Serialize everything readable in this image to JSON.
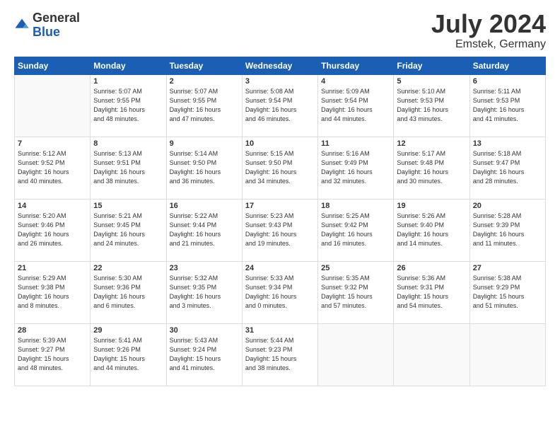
{
  "logo": {
    "general": "General",
    "blue": "Blue"
  },
  "title": {
    "month": "July 2024",
    "location": "Emstek, Germany"
  },
  "days_of_week": [
    "Sunday",
    "Monday",
    "Tuesday",
    "Wednesday",
    "Thursday",
    "Friday",
    "Saturday"
  ],
  "weeks": [
    [
      {
        "day": "",
        "info": ""
      },
      {
        "day": "1",
        "info": "Sunrise: 5:07 AM\nSunset: 9:55 PM\nDaylight: 16 hours\nand 48 minutes."
      },
      {
        "day": "2",
        "info": "Sunrise: 5:07 AM\nSunset: 9:55 PM\nDaylight: 16 hours\nand 47 minutes."
      },
      {
        "day": "3",
        "info": "Sunrise: 5:08 AM\nSunset: 9:54 PM\nDaylight: 16 hours\nand 46 minutes."
      },
      {
        "day": "4",
        "info": "Sunrise: 5:09 AM\nSunset: 9:54 PM\nDaylight: 16 hours\nand 44 minutes."
      },
      {
        "day": "5",
        "info": "Sunrise: 5:10 AM\nSunset: 9:53 PM\nDaylight: 16 hours\nand 43 minutes."
      },
      {
        "day": "6",
        "info": "Sunrise: 5:11 AM\nSunset: 9:53 PM\nDaylight: 16 hours\nand 41 minutes."
      }
    ],
    [
      {
        "day": "7",
        "info": "Sunrise: 5:12 AM\nSunset: 9:52 PM\nDaylight: 16 hours\nand 40 minutes."
      },
      {
        "day": "8",
        "info": "Sunrise: 5:13 AM\nSunset: 9:51 PM\nDaylight: 16 hours\nand 38 minutes."
      },
      {
        "day": "9",
        "info": "Sunrise: 5:14 AM\nSunset: 9:50 PM\nDaylight: 16 hours\nand 36 minutes."
      },
      {
        "day": "10",
        "info": "Sunrise: 5:15 AM\nSunset: 9:50 PM\nDaylight: 16 hours\nand 34 minutes."
      },
      {
        "day": "11",
        "info": "Sunrise: 5:16 AM\nSunset: 9:49 PM\nDaylight: 16 hours\nand 32 minutes."
      },
      {
        "day": "12",
        "info": "Sunrise: 5:17 AM\nSunset: 9:48 PM\nDaylight: 16 hours\nand 30 minutes."
      },
      {
        "day": "13",
        "info": "Sunrise: 5:18 AM\nSunset: 9:47 PM\nDaylight: 16 hours\nand 28 minutes."
      }
    ],
    [
      {
        "day": "14",
        "info": "Sunrise: 5:20 AM\nSunset: 9:46 PM\nDaylight: 16 hours\nand 26 minutes."
      },
      {
        "day": "15",
        "info": "Sunrise: 5:21 AM\nSunset: 9:45 PM\nDaylight: 16 hours\nand 24 minutes."
      },
      {
        "day": "16",
        "info": "Sunrise: 5:22 AM\nSunset: 9:44 PM\nDaylight: 16 hours\nand 21 minutes."
      },
      {
        "day": "17",
        "info": "Sunrise: 5:23 AM\nSunset: 9:43 PM\nDaylight: 16 hours\nand 19 minutes."
      },
      {
        "day": "18",
        "info": "Sunrise: 5:25 AM\nSunset: 9:42 PM\nDaylight: 16 hours\nand 16 minutes."
      },
      {
        "day": "19",
        "info": "Sunrise: 5:26 AM\nSunset: 9:40 PM\nDaylight: 16 hours\nand 14 minutes."
      },
      {
        "day": "20",
        "info": "Sunrise: 5:28 AM\nSunset: 9:39 PM\nDaylight: 16 hours\nand 11 minutes."
      }
    ],
    [
      {
        "day": "21",
        "info": "Sunrise: 5:29 AM\nSunset: 9:38 PM\nDaylight: 16 hours\nand 8 minutes."
      },
      {
        "day": "22",
        "info": "Sunrise: 5:30 AM\nSunset: 9:36 PM\nDaylight: 16 hours\nand 6 minutes."
      },
      {
        "day": "23",
        "info": "Sunrise: 5:32 AM\nSunset: 9:35 PM\nDaylight: 16 hours\nand 3 minutes."
      },
      {
        "day": "24",
        "info": "Sunrise: 5:33 AM\nSunset: 9:34 PM\nDaylight: 16 hours\nand 0 minutes."
      },
      {
        "day": "25",
        "info": "Sunrise: 5:35 AM\nSunset: 9:32 PM\nDaylight: 15 hours\nand 57 minutes."
      },
      {
        "day": "26",
        "info": "Sunrise: 5:36 AM\nSunset: 9:31 PM\nDaylight: 15 hours\nand 54 minutes."
      },
      {
        "day": "27",
        "info": "Sunrise: 5:38 AM\nSunset: 9:29 PM\nDaylight: 15 hours\nand 51 minutes."
      }
    ],
    [
      {
        "day": "28",
        "info": "Sunrise: 5:39 AM\nSunset: 9:27 PM\nDaylight: 15 hours\nand 48 minutes."
      },
      {
        "day": "29",
        "info": "Sunrise: 5:41 AM\nSunset: 9:26 PM\nDaylight: 15 hours\nand 44 minutes."
      },
      {
        "day": "30",
        "info": "Sunrise: 5:43 AM\nSunset: 9:24 PM\nDaylight: 15 hours\nand 41 minutes."
      },
      {
        "day": "31",
        "info": "Sunrise: 5:44 AM\nSunset: 9:23 PM\nDaylight: 15 hours\nand 38 minutes."
      },
      {
        "day": "",
        "info": ""
      },
      {
        "day": "",
        "info": ""
      },
      {
        "day": "",
        "info": ""
      }
    ]
  ]
}
